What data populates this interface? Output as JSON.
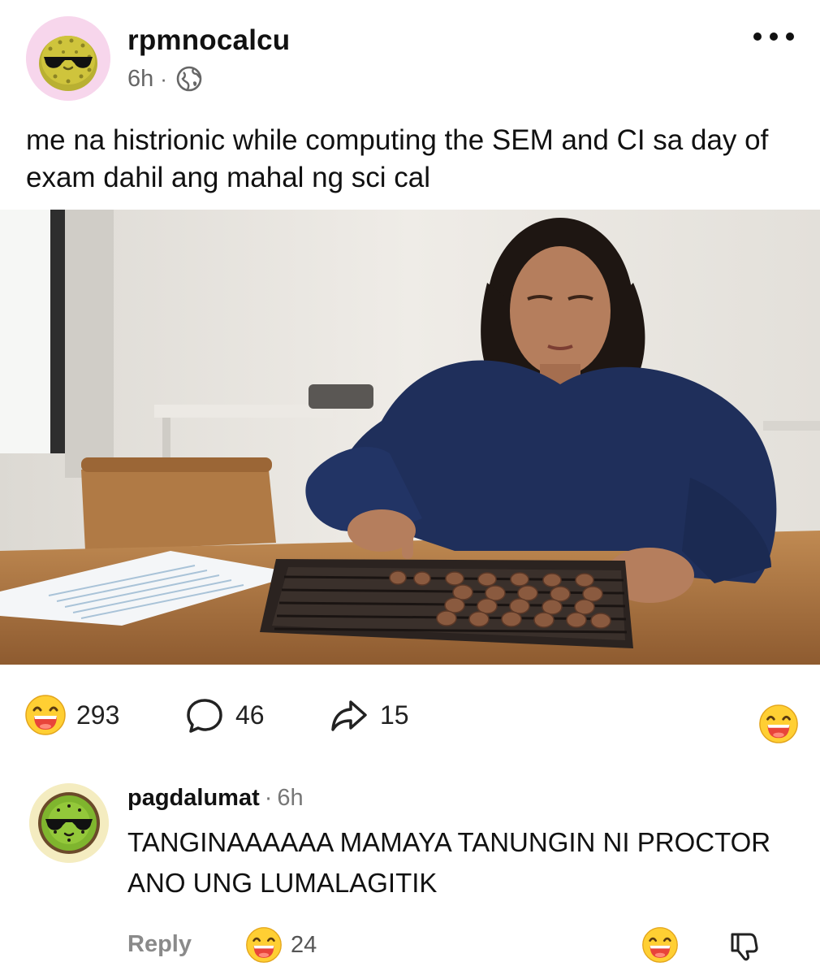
{
  "post": {
    "username": "rpmnocalcu",
    "time": "6h",
    "separator": "·",
    "caption": "me na histrionic while computing the SEM and CI sa day of exam dahil ang mahal ng sci cal",
    "icons": {
      "avatar": "durian-sunglasses-avatar",
      "visibility": "globe-icon",
      "menu": "more-horizontal-icon"
    },
    "image_icon": "photo-woman-using-abacus"
  },
  "actions": {
    "like_count": "293",
    "comment_count": "46",
    "share_count": "15",
    "like_icon": "grinning-emoji-icon",
    "comment_icon": "speech-bubble-icon",
    "share_icon": "share-arrow-icon",
    "react_icon": "grinning-emoji-icon"
  },
  "comment": {
    "username": "pagdalumat",
    "separator": "·",
    "time": "6h",
    "text": "TANGINAAAAAA MAMAYA TANUNGIN NI PROCTOR ANO UNG LUMALAGITIK",
    "reply_label": "Reply",
    "like_count": "24",
    "avatar_icon": "kiwi-sunglasses-avatar",
    "dislike_icon": "thumbs-down-icon"
  },
  "colors": {
    "text": "#111111",
    "muted": "#666666",
    "avatar_bg_post": "#f7d6ec",
    "avatar_bg_comment": "#f4ecc0",
    "emoji_face": "#ffcf33",
    "emoji_mouth": "#e8443a"
  }
}
